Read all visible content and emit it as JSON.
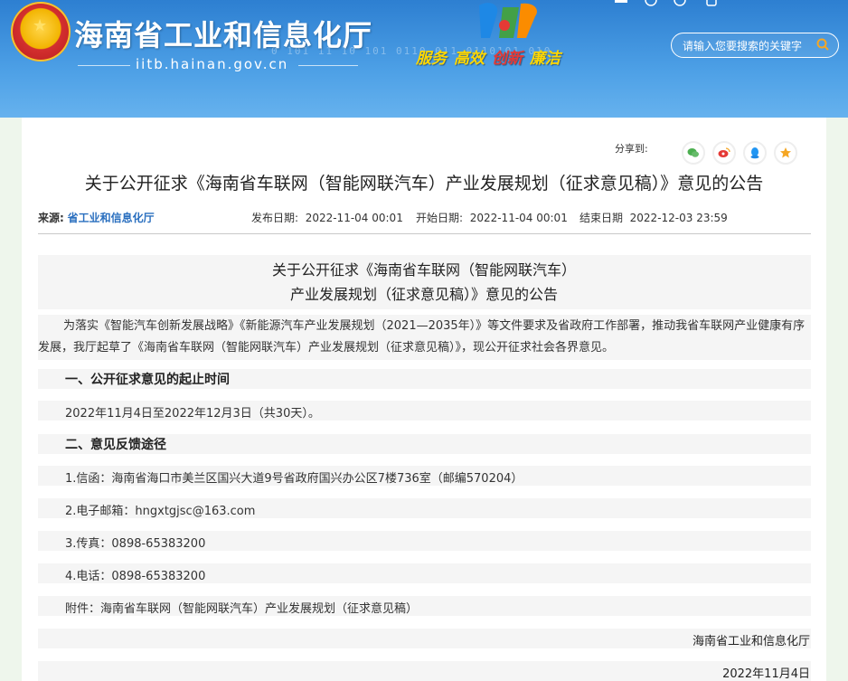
{
  "header": {
    "site_title": "海南省工业和信息化厅",
    "site_domain": "iitb.hainan.gov.cn",
    "binary_decoration": "0 101 11 10 101 0110 011 0110101 010",
    "slogan": [
      "服务",
      "高效",
      "创新",
      "廉洁"
    ],
    "search_placeholder": "请输入您要搜索的关键字"
  },
  "share": {
    "label": "分享到:",
    "buttons": [
      {
        "name": "wechat-icon",
        "color": "#4caf50"
      },
      {
        "name": "weibo-icon",
        "color": "#e53935"
      },
      {
        "name": "qq-icon",
        "color": "#2196f3"
      },
      {
        "name": "favorite-icon",
        "color": "#f5a623"
      }
    ]
  },
  "article": {
    "title": "关于公开征求《海南省车联网（智能网联汽车）产业发展规划（征求意见稿）》意见的公告",
    "source_label": "来源:",
    "source_value": "省工业和信息化厅",
    "publish_label": "发布日期:",
    "publish_value": "2022-11-04 00:01",
    "start_label": "开始日期:",
    "start_value": "2022-11-04 00:01",
    "end_label": "结束日期",
    "end_value": "2022-12-03 23:59"
  },
  "body": {
    "doc_title_line1": "关于公开征求《海南省车联网（智能网联汽车）",
    "doc_title_line2": "产业发展规划（征求意见稿）》意见的公告",
    "intro": "为落实《智能汽车创新发展战略》《新能源汽车产业发展规划（2021—2035年）》等文件要求及省政府工作部署，推动我省车联网产业健康有序发展，我厅起草了《海南省车联网（智能网联汽车）产业发展规划（征求意见稿）》，现公开征求社会各界意见。",
    "section1": "一、公开征求意见的起止时间",
    "period": "2022年11月4日至2022年12月3日（共30天）。",
    "section2": "二、意见反馈途径",
    "letter": "1.信函：海南省海口市美兰区国兴大道9号省政府国兴办公区7楼736室（邮编570204）",
    "email": "2.电子邮箱：hngxtgjsc@163.com",
    "fax": "3.传真：0898-65383200",
    "phone": "4.电话：0898-65383200",
    "attachment": "附件：海南省车联网（智能网联汽车）产业发展规划（征求意见稿）",
    "signature": "海南省工业和信息化厅",
    "date": "2022年11月4日"
  }
}
